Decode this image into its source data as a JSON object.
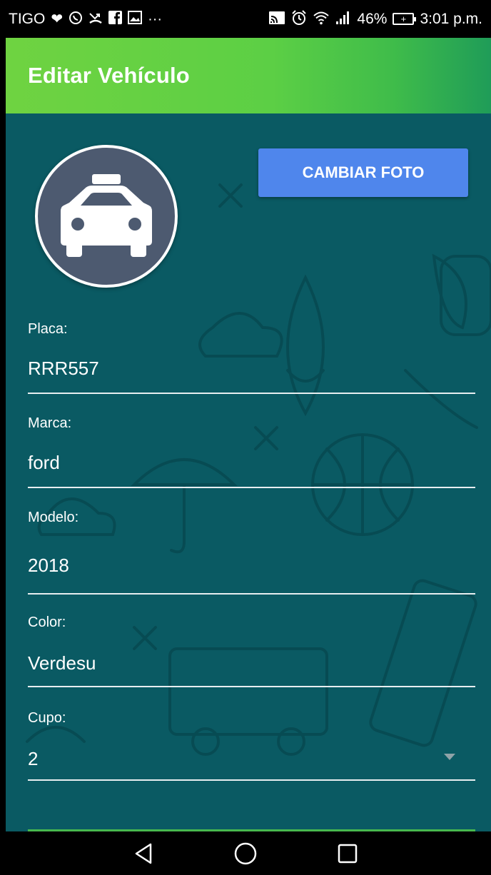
{
  "status_bar": {
    "carrier": "TIGO",
    "notification_icons": [
      "heart-icon",
      "whatsapp-icon",
      "missed-call-icon",
      "facebook-icon",
      "gallery-icon",
      "more-icon"
    ],
    "more": "···",
    "right_icons": [
      "cast-icon",
      "alarm-icon",
      "wifi-icon",
      "signal-icon"
    ],
    "battery_percent": "46%",
    "time": "3:01 p.m."
  },
  "app_bar": {
    "title": "Editar Vehículo"
  },
  "vehicle_photo": {
    "icon": "taxi-icon"
  },
  "change_photo_button": {
    "label": "CAMBIAR FOTO"
  },
  "form": {
    "placa": {
      "label": "Placa:",
      "value": "RRR557"
    },
    "marca": {
      "label": "Marca:",
      "value": "ford"
    },
    "modelo": {
      "label": "Modelo:",
      "value": "2018"
    },
    "color": {
      "label": "Color:",
      "value": "Verdesu"
    },
    "cupo": {
      "label": "Cupo:",
      "value": "2"
    }
  },
  "nav_bar": {
    "buttons": [
      "back-icon",
      "home-icon",
      "recents-icon"
    ]
  },
  "colors": {
    "app_bar_start": "#6fd341",
    "app_bar_end": "#1f9c58",
    "content_bg": "#0a5a63",
    "button_bg": "#4f86ec",
    "avatar_bg": "#4d5a70"
  }
}
